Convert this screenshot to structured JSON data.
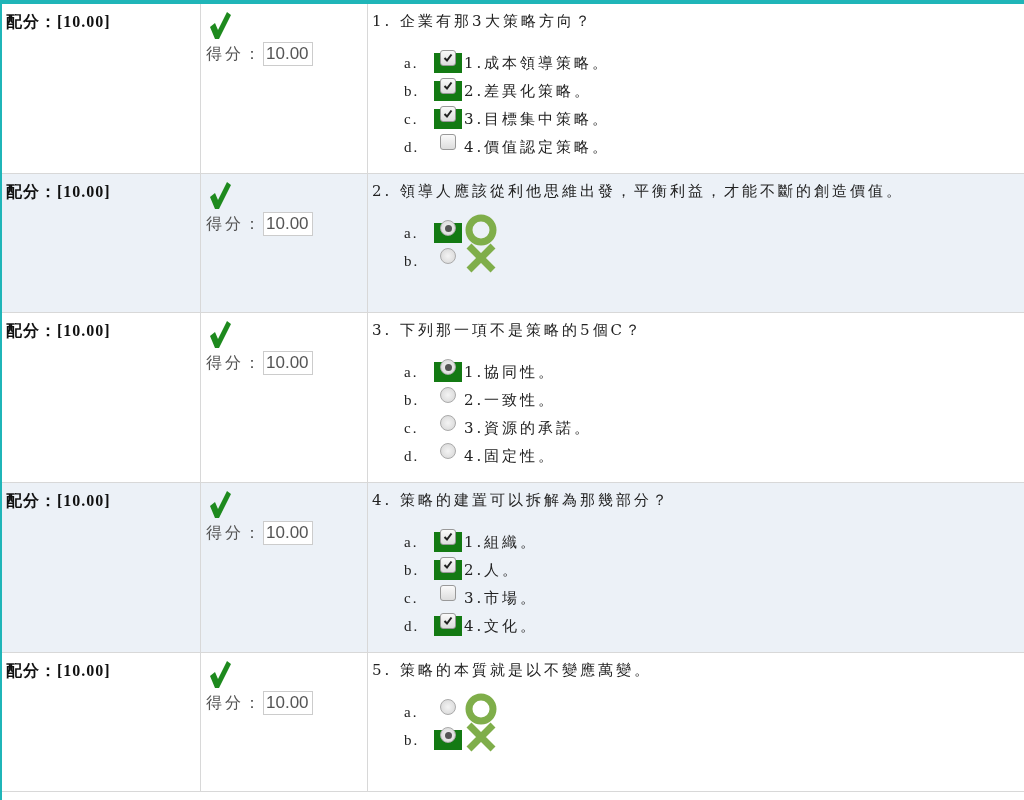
{
  "questions": [
    {
      "points": "配分：[10.00]",
      "correct": true,
      "score_label": "得分：",
      "score": "10.00",
      "number": "1.",
      "text": "企業有那3大策略方向？",
      "kind": "checkbox",
      "options": [
        {
          "letter": "a.",
          "checked": true,
          "label": "1.成本領導策略。"
        },
        {
          "letter": "b.",
          "checked": true,
          "label": "2.差異化策略。"
        },
        {
          "letter": "c.",
          "checked": true,
          "label": "3.目標集中策略。"
        },
        {
          "letter": "d.",
          "checked": false,
          "label": "4.價值認定策略。"
        }
      ]
    },
    {
      "points": "配分：[10.00]",
      "correct": true,
      "score_label": "得分：",
      "score": "10.00",
      "number": "2.",
      "text": "領導人應該從利他思維出發，平衡利益，才能不斷的創造價值。",
      "kind": "truefalse",
      "options": [
        {
          "letter": "a.",
          "checked": true,
          "kind": "circle"
        },
        {
          "letter": "b.",
          "checked": false,
          "kind": "cross"
        }
      ]
    },
    {
      "points": "配分：[10.00]",
      "correct": true,
      "score_label": "得分：",
      "score": "10.00",
      "number": "3.",
      "text": "下列那一項不是策略的5個C？",
      "kind": "radio",
      "options": [
        {
          "letter": "a.",
          "checked": true,
          "label": "1.協同性。"
        },
        {
          "letter": "b.",
          "checked": false,
          "label": "2.一致性。"
        },
        {
          "letter": "c.",
          "checked": false,
          "label": "3.資源的承諾。"
        },
        {
          "letter": "d.",
          "checked": false,
          "label": "4.固定性。"
        }
      ]
    },
    {
      "points": "配分：[10.00]",
      "correct": true,
      "score_label": "得分：",
      "score": "10.00",
      "number": "4.",
      "text": "策略的建置可以拆解為那幾部分？",
      "kind": "checkbox",
      "options": [
        {
          "letter": "a.",
          "checked": true,
          "label": "1.組織。"
        },
        {
          "letter": "b.",
          "checked": true,
          "label": "2.人。"
        },
        {
          "letter": "c.",
          "checked": false,
          "label": "3.市場。"
        },
        {
          "letter": "d.",
          "checked": true,
          "label": "4.文化。"
        }
      ]
    },
    {
      "points": "配分：[10.00]",
      "correct": true,
      "score_label": "得分：",
      "score": "10.00",
      "number": "5.",
      "text": "策略的本質就是以不變應萬變。",
      "kind": "truefalse",
      "options": [
        {
          "letter": "a.",
          "checked": false,
          "kind": "circle"
        },
        {
          "letter": "b.",
          "checked": true,
          "kind": "cross"
        }
      ]
    }
  ]
}
